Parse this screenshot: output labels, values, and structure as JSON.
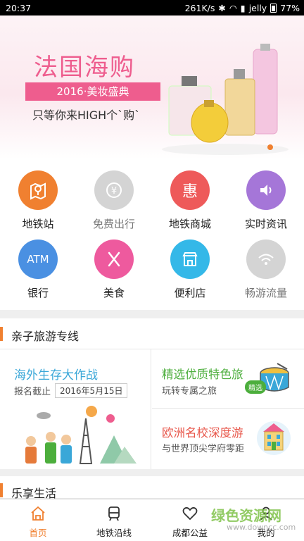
{
  "status_bar": {
    "time": "20:37",
    "speed": "261K/s",
    "carrier": "jelly",
    "battery": "77%"
  },
  "banner": {
    "title": "法国海购",
    "ribbon": "2016·美妆盛典",
    "subtitle": "只等你来HIGH个`购`",
    "accent": "#ee5d8e"
  },
  "grid": [
    {
      "label": "地铁站",
      "icon": "map-pin-icon",
      "color": "#f08030"
    },
    {
      "label": "免费出行",
      "icon": "free-coin-icon",
      "color": "#cfcfcf"
    },
    {
      "label": "地铁商城",
      "icon": "discount-icon",
      "color": "#ee5a5a",
      "glyph": "惠"
    },
    {
      "label": "实时资讯",
      "icon": "speaker-icon",
      "color": "#a576d8"
    },
    {
      "label": "银行",
      "icon": "atm-icon",
      "color": "#4a90e2",
      "glyph": "ATM"
    },
    {
      "label": "美食",
      "icon": "utensils-icon",
      "color": "#ee5a9e"
    },
    {
      "label": "便利店",
      "icon": "store-icon",
      "color": "#34b8e8"
    },
    {
      "label": "畅游流量",
      "icon": "wifi-icon",
      "color": "#cfcfcf"
    }
  ],
  "section1": {
    "title": "亲子旅游专线"
  },
  "cards": {
    "left": {
      "title": "海外生存大作战",
      "deadline_label": "报名截止",
      "date": "2016年5月15日"
    },
    "right_top": {
      "title": "精选优质特色旅",
      "subtitle": "玩转专属之旅",
      "badge": "精选"
    },
    "right_bottom": {
      "title": "欧洲名校深度游",
      "subtitle": "与世界顶尖学府零距"
    }
  },
  "section2": {
    "title": "乐享生活"
  },
  "bottom_nav": [
    {
      "label": "首页",
      "icon": "home-icon",
      "active": true
    },
    {
      "label": "地铁沿线",
      "icon": "train-icon",
      "active": false
    },
    {
      "label": "成都公益",
      "icon": "heart-icon",
      "active": false
    },
    {
      "label": "我的",
      "icon": "user-icon",
      "active": false
    }
  ],
  "watermark": {
    "text": "绿色资源网",
    "url": "www.downcc.com"
  }
}
